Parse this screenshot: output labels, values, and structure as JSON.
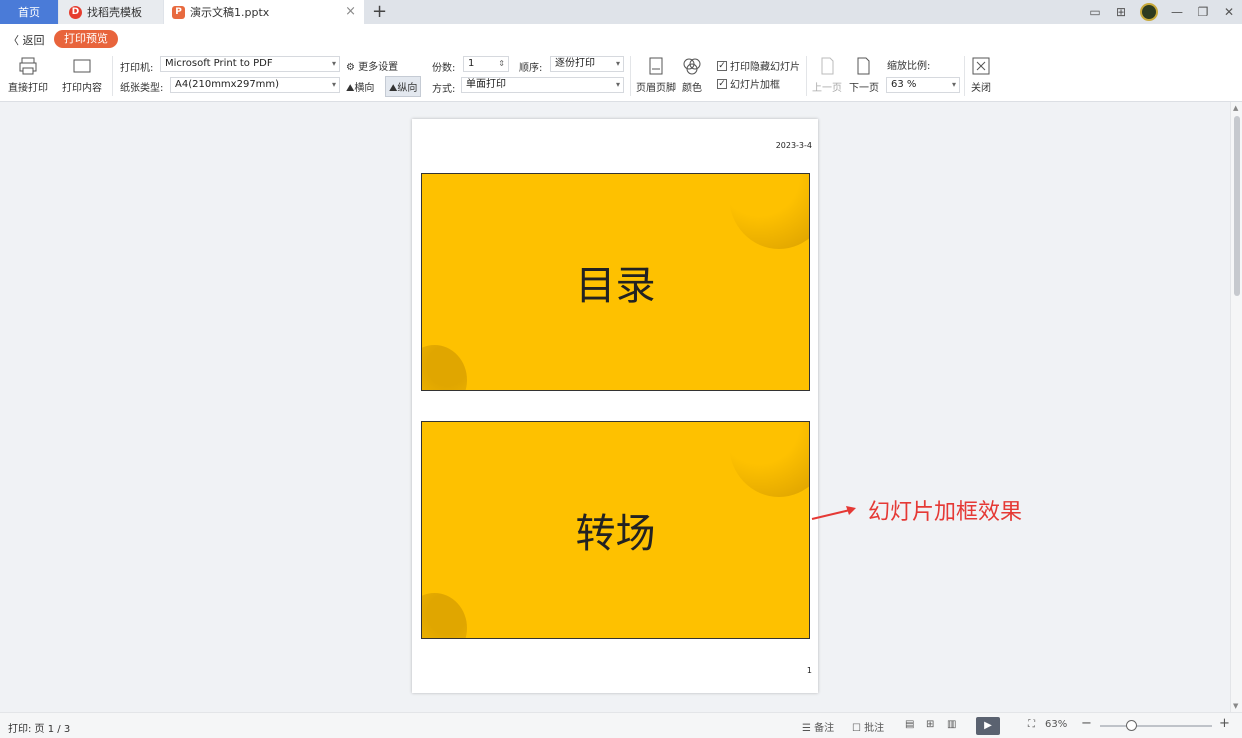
{
  "tabs": {
    "home": "首页",
    "template": "找稻壳模板",
    "document": "演示文稿1.pptx",
    "close": "×",
    "add": "+"
  },
  "toolbar": {
    "back": "返回",
    "preview_badge": "打印预览",
    "direct_print": "直接打印",
    "print_content": "打印内容",
    "printer_label": "打印机:",
    "printer_value": "Microsoft Print to PDF",
    "more_settings": "更多设置",
    "paper_label": "纸张类型:",
    "paper_value": "A4(210mmx297mm)",
    "landscape": "横向",
    "portrait": "纵向",
    "copies_label": "份数:",
    "copies_value": "1",
    "order_label": "顺序:",
    "order_value": "逐份打印",
    "mode_label": "方式:",
    "mode_value": "单面打印",
    "header_footer": "页眉页脚",
    "color": "颜色",
    "print_hidden": "打印隐藏幻灯片",
    "frame_slides": "幻灯片加框",
    "prev_page": "上一页",
    "next_page": "下一页",
    "zoom_label": "缩放比例:",
    "zoom_value": "63 %",
    "close": "关闭"
  },
  "page": {
    "date": "2023-3-4",
    "page_number": "1",
    "slides": [
      {
        "title": "目录"
      },
      {
        "title": "转场"
      }
    ]
  },
  "annotation": "幻灯片加框效果",
  "status": {
    "print_pages": "打印: 页 1 / 3",
    "notes": "备注",
    "comments": "批注",
    "zoom": "63%",
    "minus": "−",
    "plus": "+"
  },
  "colors": {
    "slide_bg": "#fec100",
    "accent": "#e8643c",
    "annotation": "#e53935",
    "home_tab": "#4a7bd8"
  }
}
